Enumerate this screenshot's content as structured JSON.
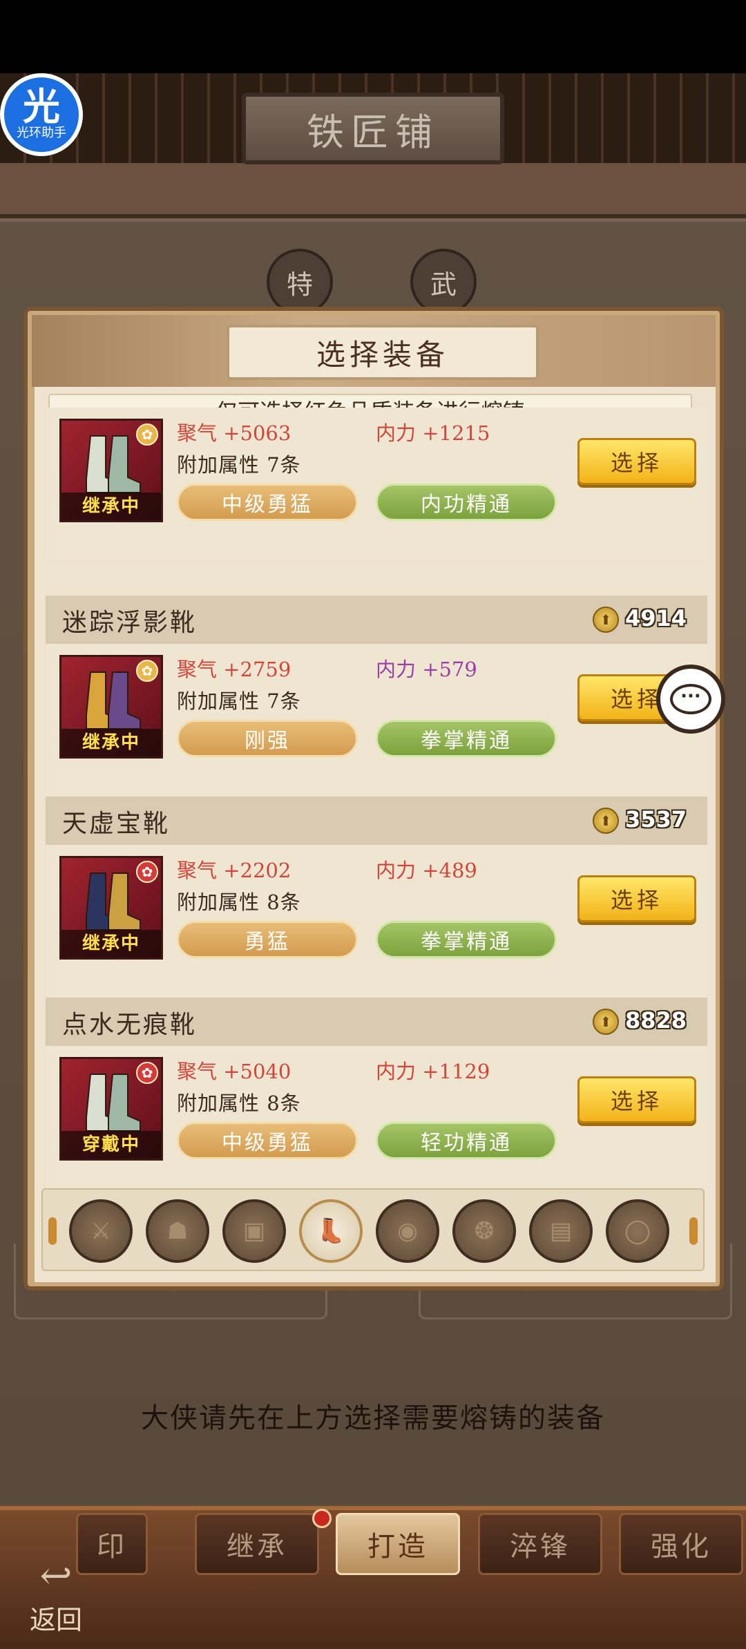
{
  "header": {
    "title": "铁匠铺",
    "badge_main": "光",
    "badge_sub": "光环助手"
  },
  "page_buttons": [
    "特",
    "武"
  ],
  "dialog": {
    "title": "选择装备",
    "notice": "仅可选择红色品质装备进行熔铸",
    "select_label": "选择",
    "items": [
      {
        "name": "",
        "price": "",
        "status": "继承中",
        "mark": "gold",
        "stat1": "聚气  +5063",
        "stat2": "内力  +1215",
        "stat2_color": "red",
        "extra": "附加属性  7条",
        "tag1": "中级勇猛",
        "tag2": "内功精通",
        "boot": "white"
      },
      {
        "name": "迷踪浮影靴",
        "price": "4914",
        "status": "继承中",
        "mark": "gold",
        "stat1": "聚气  +2759",
        "stat2": "内力  +579",
        "stat2_color": "purple",
        "extra": "附加属性  7条",
        "tag1": "刚强",
        "tag2": "拳掌精通",
        "boot": "gold"
      },
      {
        "name": "天虚宝靴",
        "price": "3537",
        "status": "继承中",
        "mark": "red",
        "stat1": "聚气  +2202",
        "stat2": "内力  +489",
        "stat2_color": "red",
        "extra": "附加属性  8条",
        "tag1": "勇猛",
        "tag2": "拳掌精通",
        "boot": "dark"
      },
      {
        "name": "点水无痕靴",
        "price": "8828",
        "status": "穿戴中",
        "mark": "red",
        "stat1": "聚气  +5040",
        "stat2": "内力  +1129",
        "stat2_color": "red",
        "extra": "附加属性  8条",
        "tag1": "中级勇猛",
        "tag2": "轻功精通",
        "boot": "white"
      }
    ],
    "categories": [
      {
        "icon": "weapon-icon",
        "glyph": "⚔",
        "active": false
      },
      {
        "icon": "helmet-icon",
        "glyph": "☗",
        "active": false
      },
      {
        "icon": "armor-icon",
        "glyph": "▣",
        "active": false
      },
      {
        "icon": "boots-icon",
        "glyph": "👢",
        "active": true
      },
      {
        "icon": "belt-icon",
        "glyph": "◉",
        "active": false
      },
      {
        "icon": "amulet-icon",
        "glyph": "❂",
        "active": false
      },
      {
        "icon": "scroll-icon",
        "glyph": "▤",
        "active": false
      },
      {
        "icon": "ring-icon",
        "glyph": "◯",
        "active": false
      }
    ]
  },
  "hint": "大侠请先在上方选择需要熔铸的装备",
  "tabs": [
    "印",
    "继承",
    "打造",
    "淬锋",
    "强化"
  ],
  "active_tab": "打造",
  "back_label": "返回",
  "colors": {
    "accent_gold": "#f2b318",
    "stat_red": "#d3453b",
    "stat_purple": "#9a3fa6",
    "quality_red": "#a0242f"
  }
}
